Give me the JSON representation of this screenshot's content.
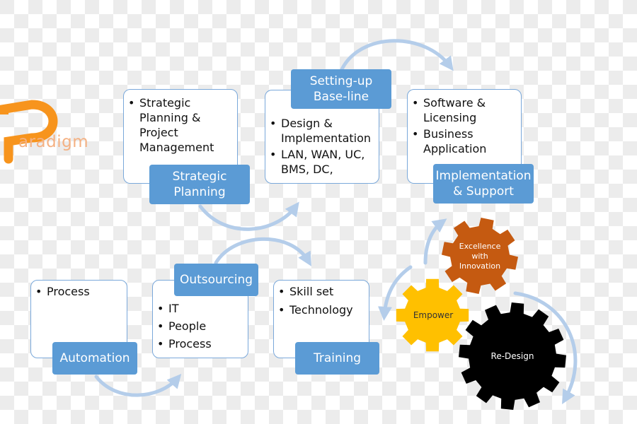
{
  "logo": {
    "letter": "P",
    "text": "aradigm",
    "color": "#f7941d"
  },
  "colors": {
    "label_bg": "#5b9bd5",
    "card_border": "#7aa8da",
    "arrow": "#b4cdea",
    "gear_orange": "#c55a11",
    "gear_yellow": "#ffc000",
    "gear_black": "#000000"
  },
  "stages": [
    {
      "id": "strategic-planning",
      "label": "Strategic\nPlanning",
      "bullets": [
        "Strategic Planning & Project Management"
      ]
    },
    {
      "id": "setting-up-baseline",
      "label": "Setting-up\nBase-line",
      "bullets": [
        "Design & Implementation",
        "LAN, WAN, UC, BMS, DC,"
      ]
    },
    {
      "id": "implementation-support",
      "label": "Implementation\n& Support",
      "bullets": [
        "Software & Licensing",
        "Business Application"
      ]
    },
    {
      "id": "automation",
      "label": "Automation",
      "bullets": [
        "Process"
      ]
    },
    {
      "id": "outsourcing",
      "label": "Outsourcing",
      "bullets": [
        "IT",
        "People",
        "Process"
      ]
    },
    {
      "id": "training",
      "label": "Training",
      "bullets": [
        "Skill set",
        "Technology"
      ]
    }
  ],
  "gears": [
    {
      "id": "excellence",
      "label": "Excellence with Innovation",
      "color": "#c55a11"
    },
    {
      "id": "empower",
      "label": "Empower",
      "color": "#ffc000"
    },
    {
      "id": "redesign",
      "label": "Re-Design",
      "color": "#000000"
    }
  ]
}
